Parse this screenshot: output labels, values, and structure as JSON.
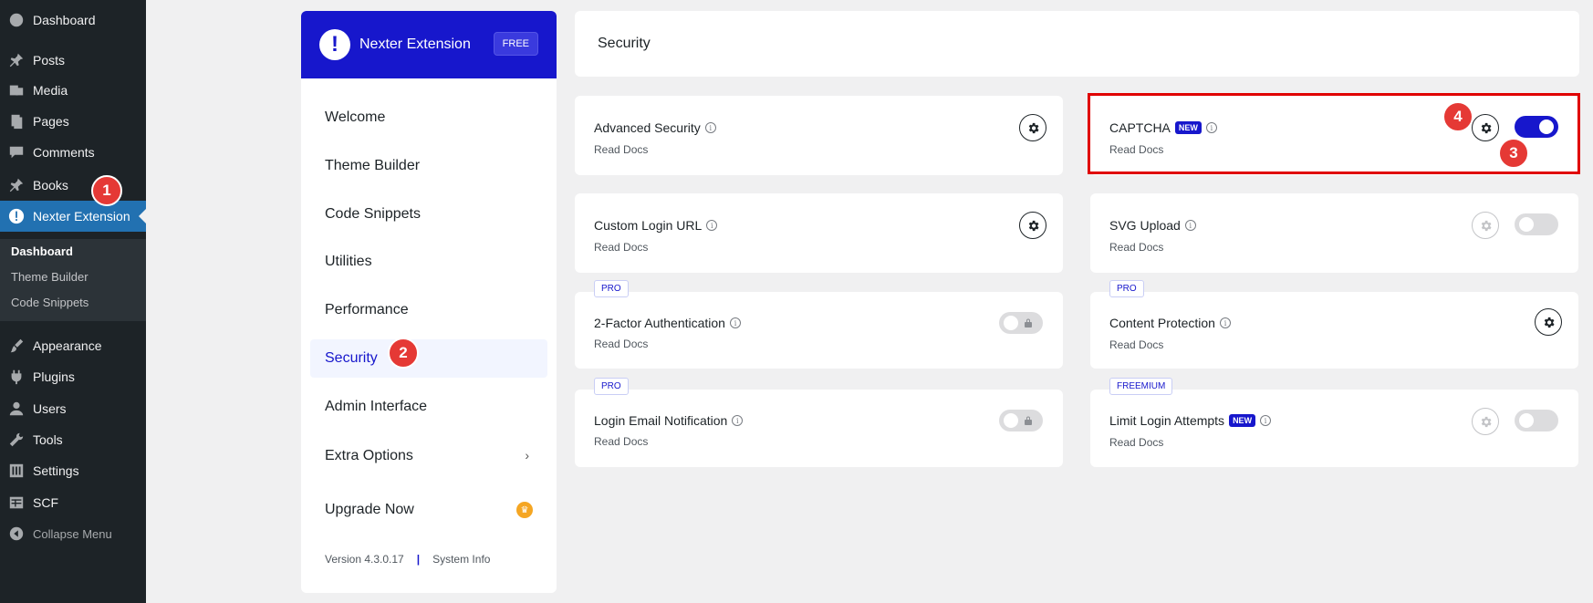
{
  "wp_menu": {
    "dashboard": "Dashboard",
    "posts": "Posts",
    "media": "Media",
    "pages": "Pages",
    "comments": "Comments",
    "books": "Books",
    "nexter": "Nexter Extension",
    "submenu": [
      "Dashboard",
      "Theme Builder",
      "Code Snippets"
    ],
    "appearance": "Appearance",
    "plugins": "Plugins",
    "users": "Users",
    "tools": "Tools",
    "settings": "Settings",
    "scf": "SCF",
    "collapse": "Collapse Menu"
  },
  "nexter_panel": {
    "logo_glyph": "!",
    "title": "Nexter Extension",
    "plan_badge": "FREE",
    "nav": [
      "Welcome",
      "Theme Builder",
      "Code Snippets",
      "Utilities",
      "Performance",
      "Security",
      "Admin Interface",
      "Extra Options",
      "Upgrade Now"
    ],
    "version": "Version 4.3.0.17",
    "separator": "|",
    "system_info": "System Info"
  },
  "page": {
    "title": "Security"
  },
  "cards": {
    "advanced_security": {
      "name": "Advanced Security",
      "docs": "Read Docs"
    },
    "captcha": {
      "name": "CAPTCHA",
      "badge": "NEW",
      "docs": "Read Docs",
      "enabled": true
    },
    "custom_login_url": {
      "name": "Custom Login URL",
      "docs": "Read Docs"
    },
    "svg_upload": {
      "name": "SVG Upload",
      "docs": "Read Docs",
      "enabled": false
    },
    "two_factor": {
      "tier": "PRO",
      "name": "2-Factor Authentication",
      "docs": "Read Docs",
      "locked": true
    },
    "content_protection": {
      "tier": "PRO",
      "name": "Content Protection",
      "docs": "Read Docs"
    },
    "login_email": {
      "tier": "PRO",
      "name": "Login Email Notification",
      "docs": "Read Docs",
      "locked": true
    },
    "limit_login": {
      "tier": "FREEMIUM",
      "name": "Limit Login Attempts",
      "badge": "NEW",
      "docs": "Read Docs",
      "enabled": false
    }
  },
  "step_markers": [
    "1",
    "2",
    "3",
    "4"
  ],
  "colors": {
    "accent": "#1717cc",
    "wp_active": "#2271b1",
    "marker": "#e53935",
    "highlight": "#e00000"
  }
}
